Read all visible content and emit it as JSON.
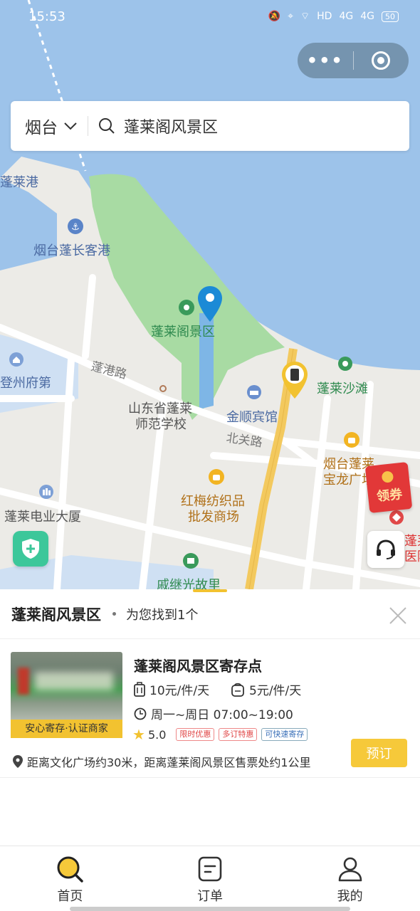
{
  "status": {
    "time": "15:53",
    "battery": "50",
    "net": "HD",
    "sig1": "4G",
    "sig2": "4G"
  },
  "capsule": {
    "more": "•••"
  },
  "search": {
    "city": "烟台",
    "query": "蓬莱阁风景区"
  },
  "map_labels": {
    "penglai_port": "蓬莱港",
    "passenger_port": "烟台蓬长客港",
    "scenic_area": "蓬莱阁景区",
    "prefecture_house": "登州府第",
    "penggang_road": "蓬港路",
    "normal_school_1": "山东省蓬莱",
    "normal_school_2": "师范学校",
    "jinshun_hotel": "金顺宾馆",
    "beach": "蓬莱沙滩",
    "beiguan_road": "北关路",
    "baolong_1": "烟台蓬莱",
    "baolong_2": "宝龙广场",
    "hongmei_1": "红梅纺织品",
    "hongmei_2": "批发商场",
    "power_tower": "蓬莱电业大厦",
    "qijiguang": "戚继光故里",
    "hospital_1": "蓬莱",
    "hospital_2": "医院",
    "coupon": "领券"
  },
  "panel": {
    "title": "蓬莱阁风景区",
    "found": "为您找到1个",
    "card": {
      "name": "蓬莱阁风景区寄存点",
      "price_luggage": "10元/件/天",
      "price_bag": "5元/件/天",
      "hours": "周一~周日 07:00~19:00",
      "rating": "5.0",
      "tags": [
        "限时优惠",
        "多订特惠",
        "可快速寄存"
      ],
      "thumb_tag": "安心寄存·认证商家",
      "address": "距离文化广场约30米，距离蓬莱阁风景区售票处约1公里",
      "book": "预订"
    }
  },
  "tabs": [
    {
      "label": "首页",
      "icon": "home-search-icon"
    },
    {
      "label": "订单",
      "icon": "order-icon"
    },
    {
      "label": "我的",
      "icon": "profile-icon"
    }
  ],
  "colors": {
    "accent": "#f2c230",
    "sea": "#9dc3ea",
    "park": "#a8dba3",
    "road": "#f3c95e",
    "pin": "#1b8ad6"
  }
}
